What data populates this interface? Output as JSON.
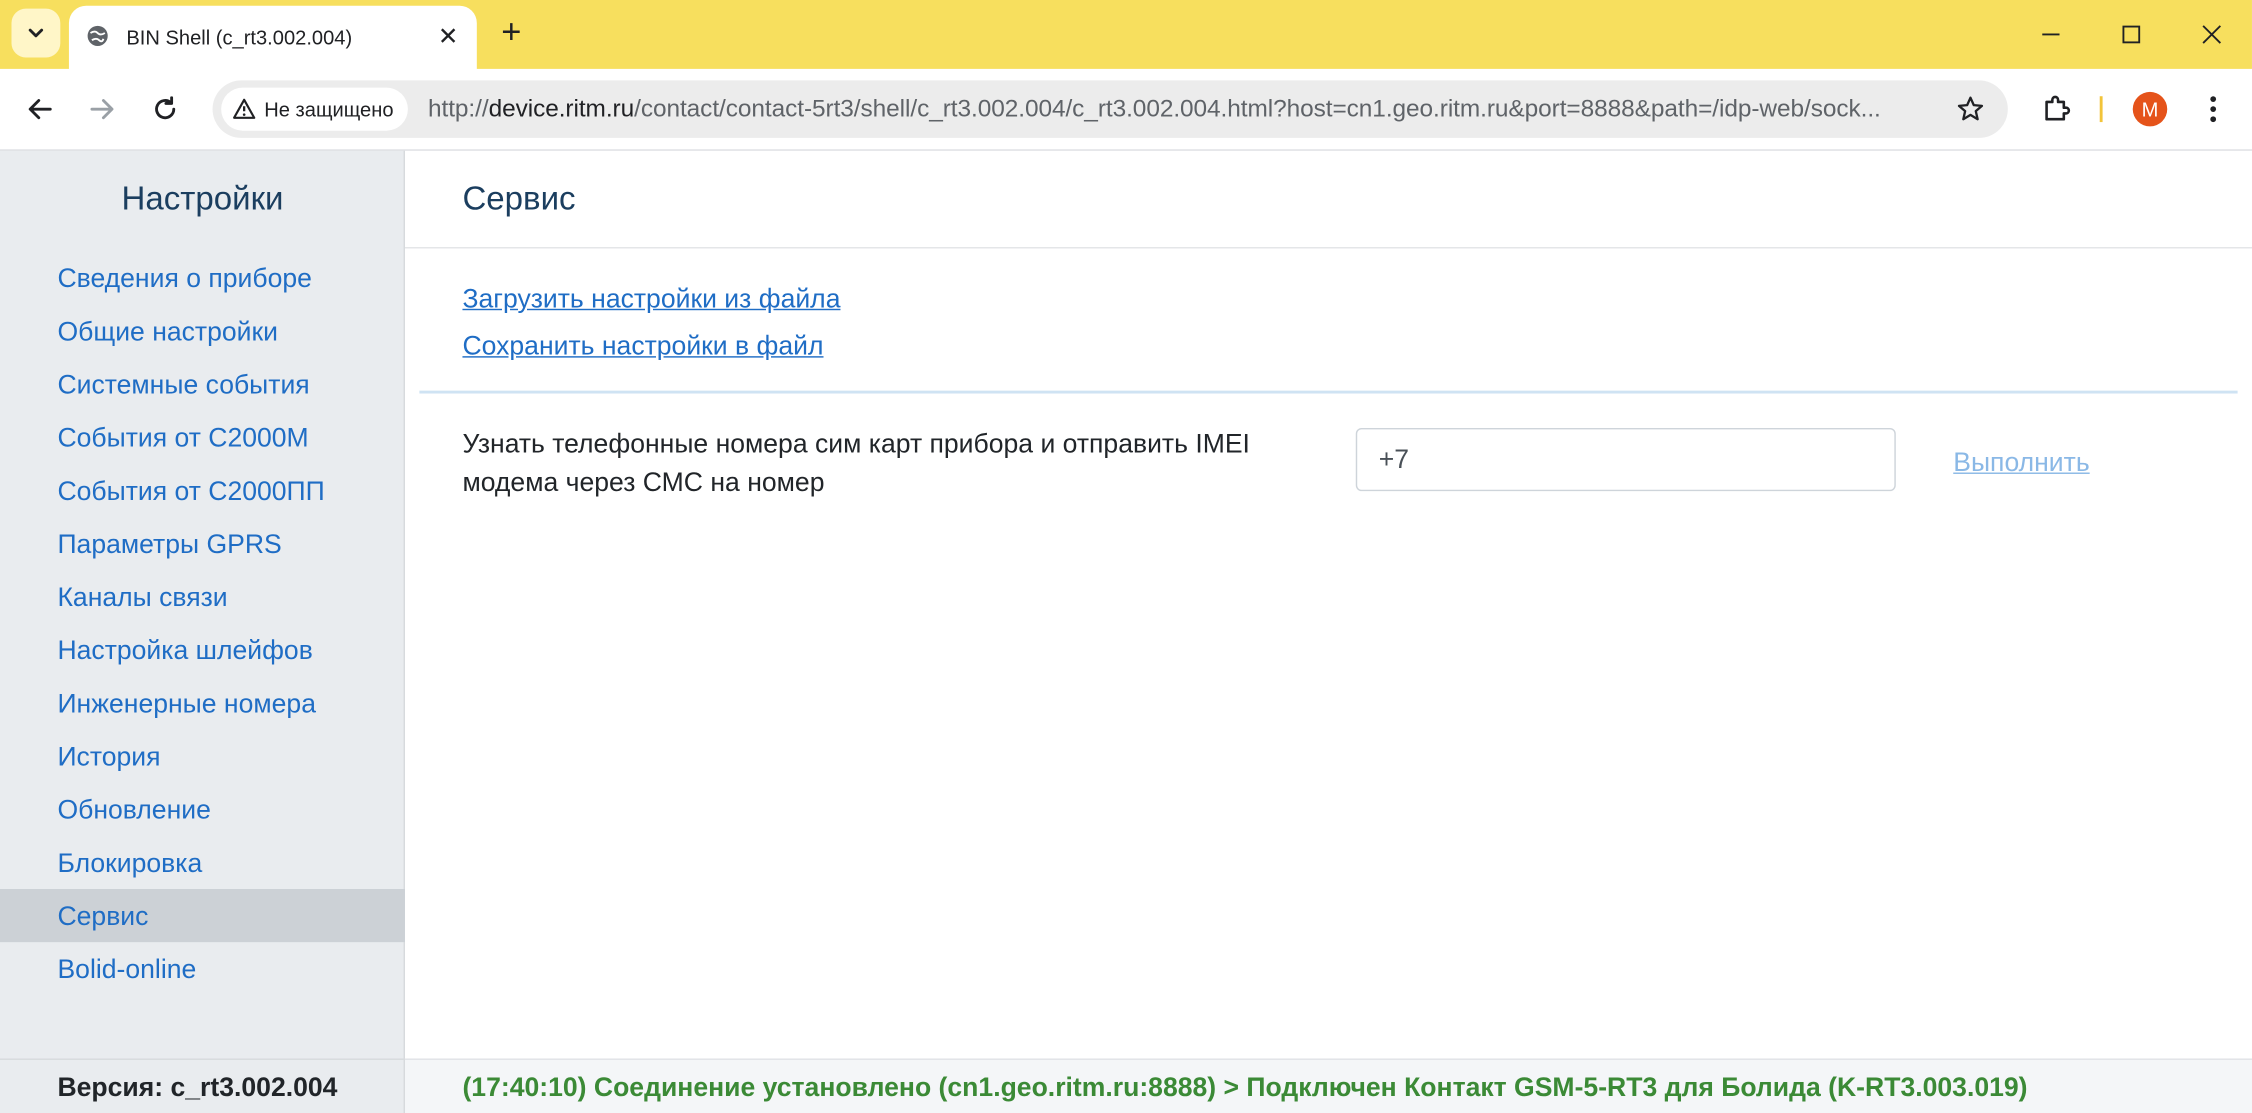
{
  "browser": {
    "tab_title": "BIN Shell (c_rt3.002.004)",
    "security_label": "Не защищено",
    "url_prefix": "http://",
    "url_host": "device.ritm.ru",
    "url_path": "/contact/contact-5rt3/shell/c_rt3.002.004/c_rt3.002.004.html?host=cn1.geo.ritm.ru&port=8888&path=/idp-web/sock...",
    "profile_initial": "M",
    "accent_color": "#f7df5e"
  },
  "sidebar": {
    "title": "Настройки",
    "items": [
      {
        "label": "Сведения о приборе"
      },
      {
        "label": "Общие настройки"
      },
      {
        "label": "Системные события"
      },
      {
        "label": "События от С2000М"
      },
      {
        "label": "События от С2000ПП"
      },
      {
        "label": "Параметры GPRS"
      },
      {
        "label": "Каналы связи"
      },
      {
        "label": "Настройка шлейфов"
      },
      {
        "label": "Инженерные номера"
      },
      {
        "label": "История"
      },
      {
        "label": "Обновление"
      },
      {
        "label": "Блокировка"
      },
      {
        "label": "Сервис",
        "active": true
      },
      {
        "label": "Bolid-online"
      }
    ]
  },
  "main": {
    "title": "Сервис",
    "load_link": "Загрузить настройки из файла",
    "save_link": "Сохранить настройки в файл",
    "sms_description": "Узнать телефонные номера сим карт прибора и отправить IMEI модема через СМС на номер",
    "phone_value": "+7",
    "execute_label": "Выполнить"
  },
  "footer": {
    "version": "Версия: c_rt3.002.004",
    "status": "(17:40:10) Соединение установлено (cn1.geo.ritm.ru:8888) > Подключен Контакт GSM-5-RT3 для Болида (K-RT3.003.019)"
  }
}
